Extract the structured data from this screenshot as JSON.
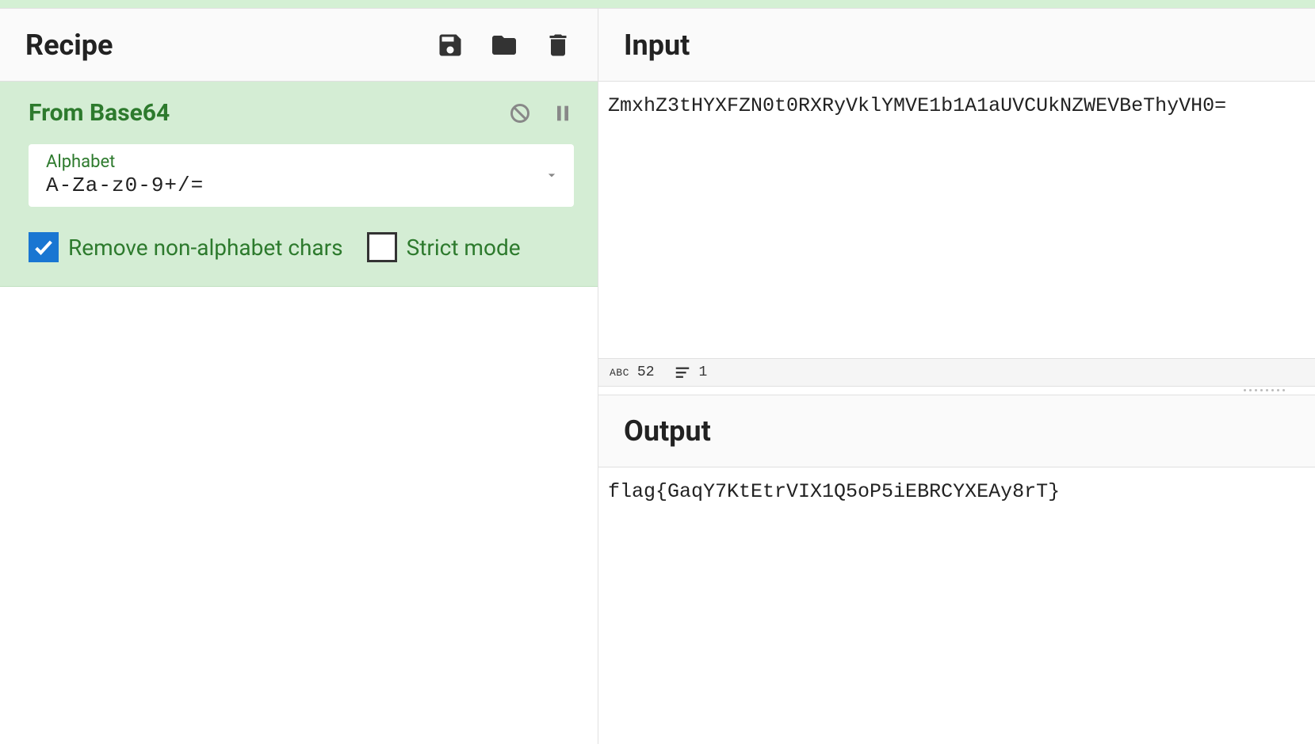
{
  "recipe": {
    "title": "Recipe",
    "operation": {
      "name": "From Base64",
      "alphabet_label": "Alphabet",
      "alphabet_value": "A-Za-z0-9+/=",
      "remove_non_alpha": {
        "label": "Remove non-alphabet chars",
        "checked": true
      },
      "strict_mode": {
        "label": "Strict mode",
        "checked": false
      }
    }
  },
  "input": {
    "title": "Input",
    "value": "ZmxhZ3tHYXFZN0t0RXRyVklYMVE1b1A1aUVCUkNZWEVBeThyVH0="
  },
  "status": {
    "chars": "52",
    "lines": "1"
  },
  "output": {
    "title": "Output",
    "value": "flag{GaqY7KtEtrVIX1Q5oP5iEBRCYXEAy8rT}"
  }
}
